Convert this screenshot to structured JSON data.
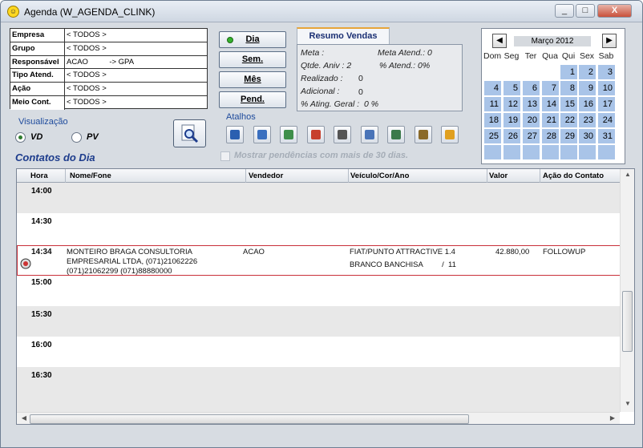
{
  "window": {
    "title": "Agenda (W_AGENDA_CLINK)",
    "minimize": "_",
    "maximize": "□",
    "close": "X"
  },
  "filters": [
    {
      "label": "Empresa",
      "value": "< TODOS >"
    },
    {
      "label": "Grupo",
      "value": "< TODOS >"
    },
    {
      "label": "Responsável",
      "value": "ACAO          -> GPA"
    },
    {
      "label": "Tipo Atend.",
      "value": "< TODOS >"
    },
    {
      "label": "Ação",
      "value": "< TODOS >"
    },
    {
      "label": "Meio Cont.",
      "value": "< TODOS >"
    }
  ],
  "nav_buttons": {
    "dia": "Dia",
    "sem": "Sem.",
    "mes": "Mês",
    "pend": "Pend."
  },
  "resumo": {
    "tab": "Resumo Vendas",
    "meta": "Meta :",
    "meta_atend": "Meta Atend.: 0",
    "qtde_aniv": "Qtde. Aniv : 2",
    "pct_atend": "% Atend.: 0%",
    "realizado": "Realizado :",
    "realizado_val": "0",
    "adicional": "Adicional :",
    "adicional_val": "0",
    "pct_ating": "% Ating. Geral :  0 %"
  },
  "calendar": {
    "month": "Março 2012",
    "prev": "◀",
    "next": "▶",
    "dow": [
      "Dom",
      "Seg",
      "Ter",
      "Qua",
      "Qui",
      "Sex",
      "Sab"
    ],
    "weeks": [
      [
        "",
        "",
        "",
        "",
        "1",
        "2",
        "3"
      ],
      [
        "4",
        "5",
        "6",
        "7",
        "8",
        "9",
        "10"
      ],
      [
        "11",
        "12",
        "13",
        "14",
        "15",
        "16",
        "17"
      ],
      [
        "18",
        "19",
        "20",
        "21",
        "22",
        "23",
        "24"
      ],
      [
        "25",
        "26",
        "27",
        "28",
        "29",
        "30",
        "31"
      ],
      [
        "",
        "",
        "",
        "",
        "",
        "",
        ""
      ]
    ]
  },
  "visualizacao": {
    "label": "Visualização",
    "vd": "VD",
    "pv": "PV",
    "selected": "VD"
  },
  "atalhos": {
    "label": "Atalhos",
    "icons": [
      "car-icon",
      "person-icon",
      "printer-icon",
      "card-icon",
      "tire-icon",
      "chart-icon",
      "calculator-icon",
      "gear-icon",
      "coins-icon"
    ],
    "colors": [
      "#2b5fb0",
      "#3a6fbf",
      "#3f8f4a",
      "#c7402d",
      "#555555",
      "#4a74b8",
      "#3c7a4b",
      "#8a6a2a",
      "#e0a020"
    ]
  },
  "mostrar": {
    "label": "Mostrar pendências com mais de 30 dias.",
    "checked": false
  },
  "contatos_title": "Contatos do Dia",
  "grid": {
    "headers": [
      "Hora",
      "Nome/Fone",
      "Vendedor",
      "Veículo/Cor/Ano",
      "Valor",
      "Ação do Contato"
    ],
    "slots": [
      "14:00",
      "14:30",
      "15:00",
      "15:30",
      "16:00",
      "16:30"
    ],
    "appointment": {
      "time": "14:34",
      "name_line1": "MONTEIRO BRAGA CONSULTORIA",
      "name_line2": "EMPRESARIAL LTDA, (071)21062226",
      "name_line3": "(071)21062299 (071)88880000",
      "vendedor": "ACAO",
      "veiculo_line1": "FIAT/PUNTO ATTRACTIVE 1.4",
      "veiculo_line2": "BRANCO BANCHISA         /  11",
      "valor": "42.880,00",
      "acao": "FOLLOWUP"
    }
  }
}
